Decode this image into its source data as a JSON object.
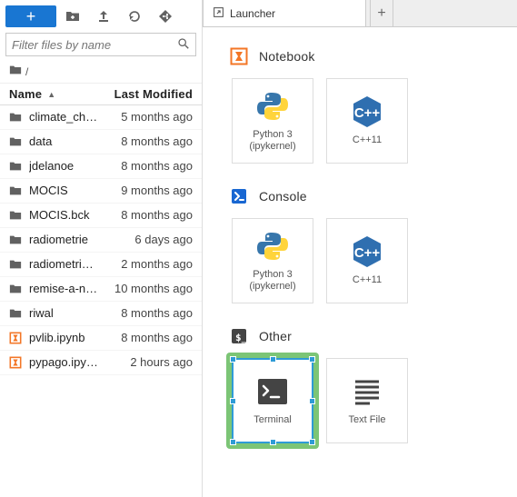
{
  "toolbar": {
    "new_label": "+"
  },
  "filter": {
    "placeholder": "Filter files by name"
  },
  "breadcrumb": {
    "path": "/"
  },
  "columns": {
    "name": "Name",
    "modified": "Last Modified",
    "sort_indicator": "▲"
  },
  "files": [
    {
      "name": "climate_ch…",
      "modified": "5 months ago",
      "kind": "folder"
    },
    {
      "name": "data",
      "modified": "8 months ago",
      "kind": "folder"
    },
    {
      "name": "jdelanoe",
      "modified": "8 months ago",
      "kind": "folder"
    },
    {
      "name": "MOCIS",
      "modified": "9 months ago",
      "kind": "folder"
    },
    {
      "name": "MOCIS.bck",
      "modified": "8 months ago",
      "kind": "folder"
    },
    {
      "name": "radiometrie",
      "modified": "6 days ago",
      "kind": "folder"
    },
    {
      "name": "radiometri…",
      "modified": "2 months ago",
      "kind": "folder"
    },
    {
      "name": "remise-a-n…",
      "modified": "10 months ago",
      "kind": "folder"
    },
    {
      "name": "riwal",
      "modified": "8 months ago",
      "kind": "folder"
    },
    {
      "name": "pvlib.ipynb",
      "modified": "8 months ago",
      "kind": "notebook"
    },
    {
      "name": "pypago.ipy…",
      "modified": "2 hours ago",
      "kind": "notebook"
    }
  ],
  "tab": {
    "title": "Launcher",
    "newtab_label": "+"
  },
  "launcher": {
    "sections": [
      {
        "title": "Notebook",
        "icon": "notebook-icon",
        "cards": [
          {
            "label": "Python 3 (ipykernel)",
            "icon": "python-icon"
          },
          {
            "label": "C++11",
            "icon": "cpp-icon"
          }
        ]
      },
      {
        "title": "Console",
        "icon": "console-icon",
        "cards": [
          {
            "label": "Python 3 (ipykernel)",
            "icon": "python-icon"
          },
          {
            "label": "C++11",
            "icon": "cpp-icon"
          }
        ]
      },
      {
        "title": "Other",
        "icon": "terminal-icon",
        "cards": [
          {
            "label": "Terminal",
            "icon": "terminal-icon",
            "selected": true
          },
          {
            "label": "Text File",
            "icon": "textfile-icon"
          }
        ]
      }
    ]
  }
}
